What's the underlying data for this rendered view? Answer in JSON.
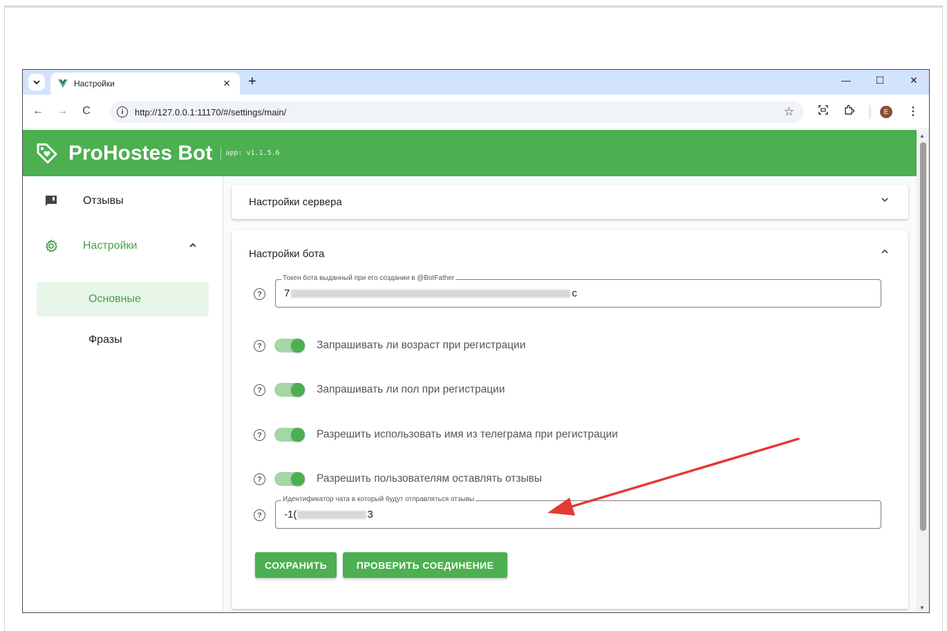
{
  "browser": {
    "tab_title": "Настройки",
    "url": "http://127.0.0.1:11170/#/settings/main/",
    "avatar_letter": "E",
    "new_tab": "+",
    "tab_close": "✕",
    "minimize": "—",
    "maximize": "☐",
    "close": "✕"
  },
  "app": {
    "title": "ProHostes Bot",
    "version": "app: v1.1.5.6",
    "accent_color": "#4caf50"
  },
  "sidebar": {
    "items": [
      {
        "label": "Отзывы",
        "icon": "feedback-icon"
      },
      {
        "label": "Настройки",
        "icon": "gear-icon"
      }
    ],
    "subitems": [
      {
        "label": "Основные",
        "active": true
      },
      {
        "label": "Фразы",
        "active": false
      }
    ]
  },
  "server_panel": {
    "title": "Настройки сервера"
  },
  "bot_panel": {
    "title": "Настройки бота",
    "token_field": {
      "legend": "Токен бота выданный при его создании в @BotFather",
      "value_start": "7",
      "value_end": "c"
    },
    "toggles": [
      {
        "label": "Запрашивать ли возраст при регистрации",
        "on": true
      },
      {
        "label": "Запрашивать ли пол при регистрации",
        "on": true
      },
      {
        "label": "Разрешить использовать имя из телеграма при регистрации",
        "on": true
      },
      {
        "label": "Разрешить пользователям оставлять отзывы",
        "on": true
      }
    ],
    "chat_field": {
      "legend": "Идентификатор чата в который будут отправляться отзывы",
      "value_start": "-1(",
      "value_end": "3"
    },
    "save_button": "СОХРАНИТЬ",
    "check_button": "ПРОВЕРИТЬ СОЕДИНЕНИЕ"
  },
  "help_glyph": "?",
  "annotation_color": "#e53935"
}
